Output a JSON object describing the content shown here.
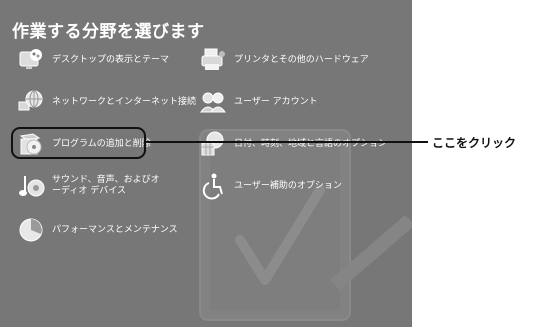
{
  "window": {
    "title": "作業する分野を選びます"
  },
  "categories": [
    {
      "label": "デスクトップの表示とテーマ",
      "icon": "desktop-theme-icon"
    },
    {
      "label": "プリンタとその他のハードウェア",
      "icon": "printer-hardware-icon"
    },
    {
      "label": "ネットワークとインターネット接続",
      "icon": "network-globe-icon"
    },
    {
      "label": "ユーザー アカウント",
      "icon": "user-accounts-icon"
    },
    {
      "label": "プログラムの追加と削除",
      "icon": "add-remove-programs-icon"
    },
    {
      "label": "日付、時刻、地域と言語のオプション",
      "icon": "date-time-region-icon"
    },
    {
      "label": "サウンド、音声、およびオーディオ デバイス",
      "icon": "sound-audio-icon"
    },
    {
      "label": "ユーザー補助のオプション",
      "icon": "accessibility-icon"
    },
    {
      "label": "パフォーマンスとメンテナンス",
      "icon": "performance-maintenance-icon"
    }
  ],
  "annotation": {
    "text": "ここをクリック"
  },
  "colors": {
    "panel_background": "#777777",
    "text": "#ffffff",
    "annotation": "#111111"
  }
}
